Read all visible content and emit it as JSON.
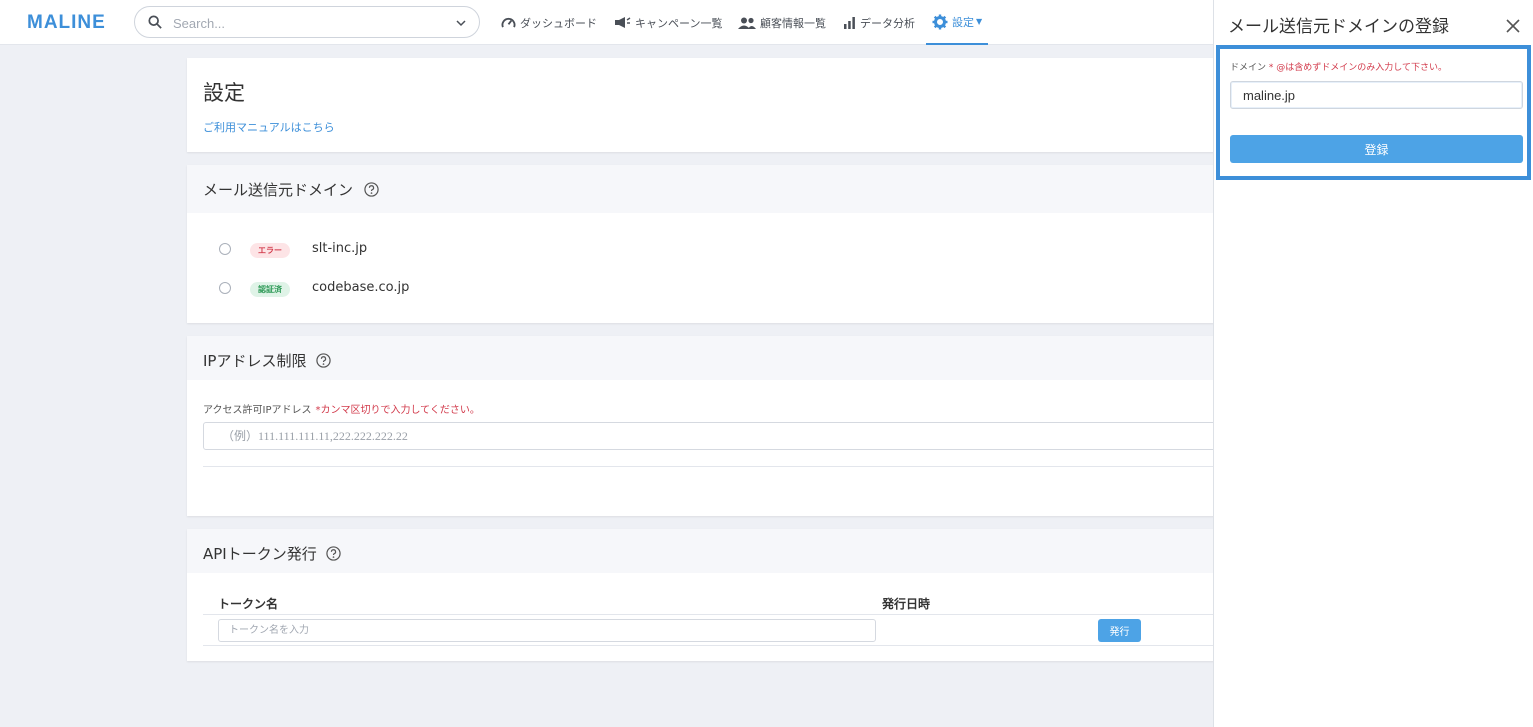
{
  "app": {
    "logo": "MALINE"
  },
  "search": {
    "placeholder": "Search..."
  },
  "nav": [
    {
      "label": "ダッシュボード",
      "icon": "dashboard-gauge-icon"
    },
    {
      "label": "キャンペーン一覧",
      "icon": "megaphone-icon"
    },
    {
      "label": "顧客情報一覧",
      "icon": "people-icon"
    },
    {
      "label": "データ分析",
      "icon": "bar-chart-icon"
    },
    {
      "label": "設定",
      "icon": "gear-icon",
      "active": true
    }
  ],
  "settings": {
    "title": "設定",
    "manual_link": "ご利用マニュアルはこちら"
  },
  "mail_domain": {
    "title": "メール送信元ドメイン",
    "items": [
      {
        "status": "エラー",
        "domain": "slt-inc.jp"
      },
      {
        "status": "認証済",
        "domain": "codebase.co.jp"
      }
    ]
  },
  "ip_restriction": {
    "title": "IPアドレス制限",
    "label": "アクセス許可IPアドレス",
    "note": "*カンマ区切りで入力してください。",
    "placeholder": "（例）111.111.111.11,222.222.222.22"
  },
  "api_token": {
    "title": "APIトークン発行",
    "col_name": "トークン名",
    "col_date": "発行日時",
    "input_placeholder": "トークン名を入力",
    "issue_button": "発行"
  },
  "panel": {
    "title": "メール送信元ドメインの登録",
    "field_name": "ドメイン",
    "field_note": "* @は含めずドメインのみ入力して下さい。",
    "domain_value": "maline.jp",
    "submit": "登録"
  },
  "colors": {
    "accent": "#3d8fd9",
    "button": "#4da3e6",
    "error": "#d23a4b",
    "success": "#2e9a57"
  }
}
